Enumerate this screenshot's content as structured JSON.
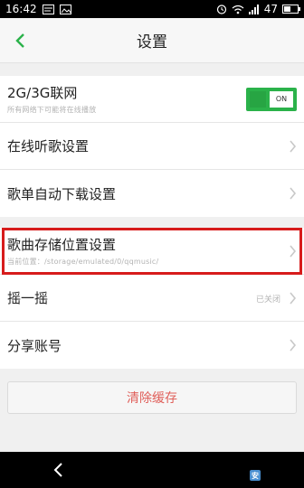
{
  "status_bar": {
    "time": "16:42",
    "signal_text": "47"
  },
  "header": {
    "title": "设置",
    "back_icon": "chevron-left-icon"
  },
  "settings": {
    "network": {
      "label": "2G/3G联网",
      "sub": "所有网络下可能将在线播放",
      "toggle": "ON",
      "enabled": true
    },
    "online_listen": {
      "label": "在线听歌设置"
    },
    "playlist_download": {
      "label": "歌单自动下载设置"
    },
    "storage": {
      "label": "歌曲存储位置设置",
      "sub": "当前位置：/storage/emulated/0/qqmusic/"
    },
    "shake": {
      "label": "摇一摇",
      "value": "已关闭"
    },
    "share": {
      "label": "分享账号"
    }
  },
  "clear_cache": {
    "label": "清除缓存"
  },
  "colors": {
    "accent": "#2bb24a",
    "highlight": "#d71c1c",
    "danger_text": "#e0605b"
  }
}
